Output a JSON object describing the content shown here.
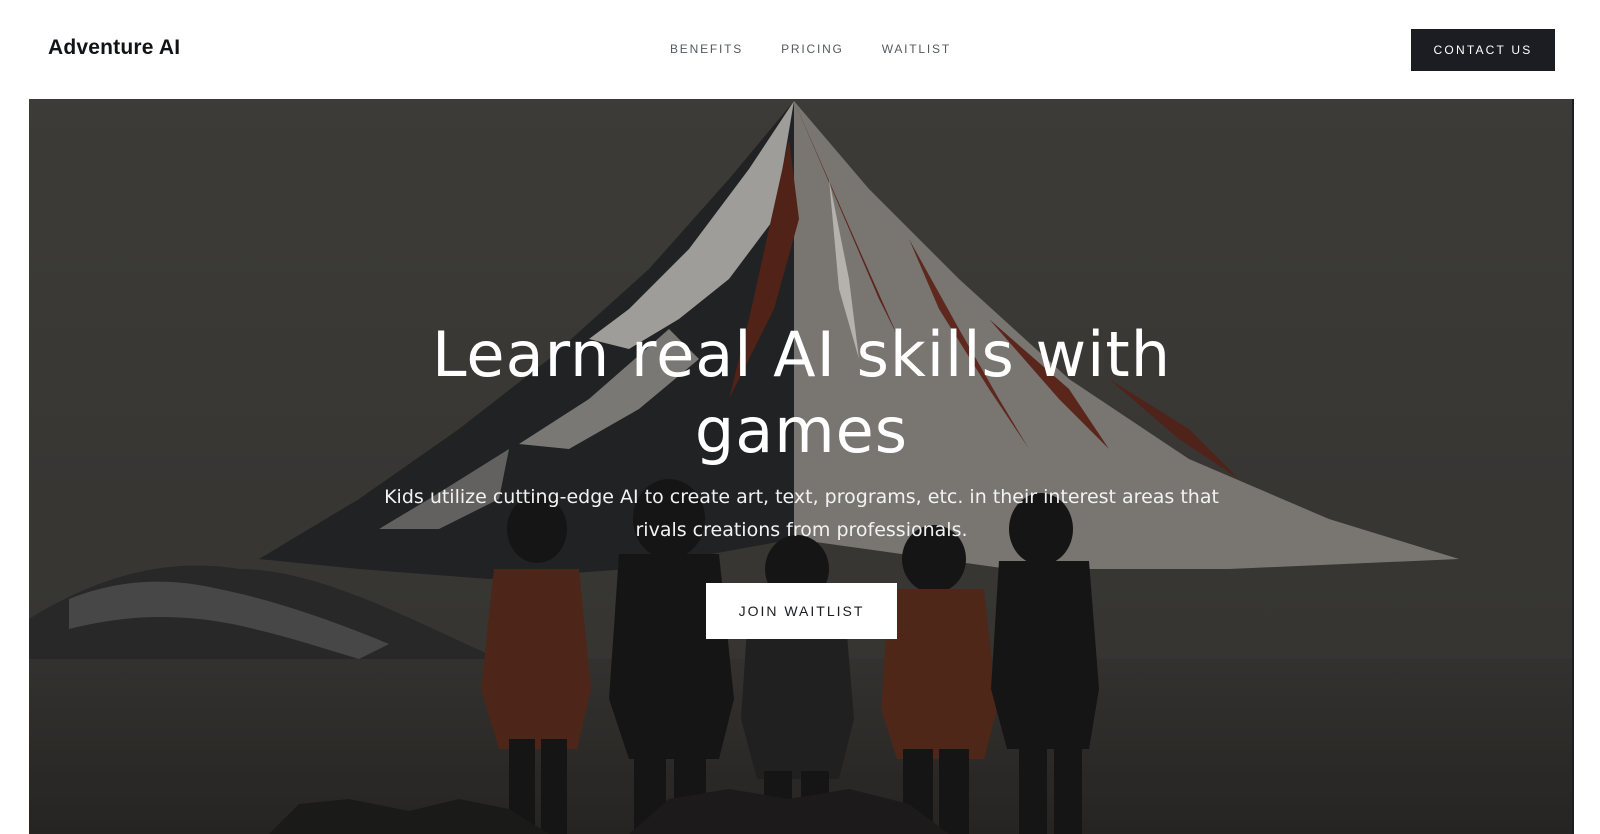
{
  "brand": {
    "name": "Adventure AI"
  },
  "nav": {
    "items": [
      {
        "label": "BENEFITS"
      },
      {
        "label": "PRICING"
      },
      {
        "label": "WAITLIST"
      }
    ]
  },
  "header": {
    "contact_label": "CONTACT US"
  },
  "hero": {
    "title": "Learn real AI skills with games",
    "subtitle": "Kids utilize cutting-edge AI to create art, text, programs, etc. in their interest areas that rivals creations from professionals.",
    "cta_label": "JOIN WAITLIST"
  },
  "colors": {
    "dark_button": "#1b1d23",
    "hero_text": "#ffffff",
    "nav_text": "#555a60"
  }
}
